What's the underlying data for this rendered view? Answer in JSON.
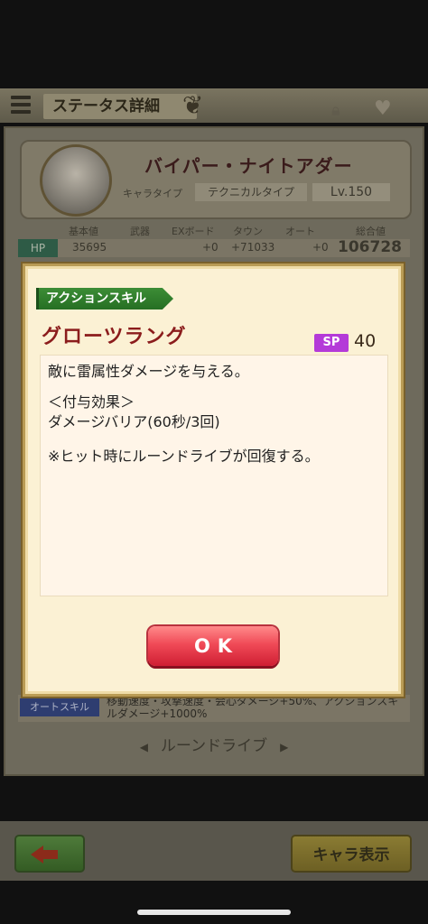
{
  "header": {
    "title": "ステータス詳細"
  },
  "character": {
    "name": "バイパー・ナイトアダー",
    "type_label": "キャラタイプ",
    "type_value": "テクニカルタイプ",
    "level": "Lv.150"
  },
  "stats": {
    "headers": [
      "基本値",
      "武器",
      "EXボード",
      "タウン",
      "オート",
      "総合値"
    ],
    "hp_label": "HP",
    "hp_values": [
      "35695",
      "",
      "+0",
      "+71033",
      "+0",
      "106728"
    ]
  },
  "auto_skill": {
    "label": "オートスキル",
    "text": "移動速度・攻撃速度・会心ダメージ+50%、アクションスキルダメージ+1000%"
  },
  "rune_drive_heading": "ルーンドライブ",
  "bottom_bar": {
    "chara_display_label": "キャラ表示"
  },
  "modal": {
    "skill_type": "アクションスキル",
    "skill_name": "グローツラング",
    "sp_label": "SP",
    "sp_value": "40",
    "description": [
      "敵に雷属性ダメージを与える。",
      "",
      "＜付与効果＞",
      "ダメージバリア(60秒/3回)",
      "",
      "※ヒット時にルーンドライブが回復する。"
    ],
    "ok_label": "OK"
  },
  "colors": {
    "skill_tab": "#2f7f2c",
    "skill_name": "#8b1c1c",
    "sp_badge": "#b43ad8",
    "ok_button": "#f04a57"
  }
}
